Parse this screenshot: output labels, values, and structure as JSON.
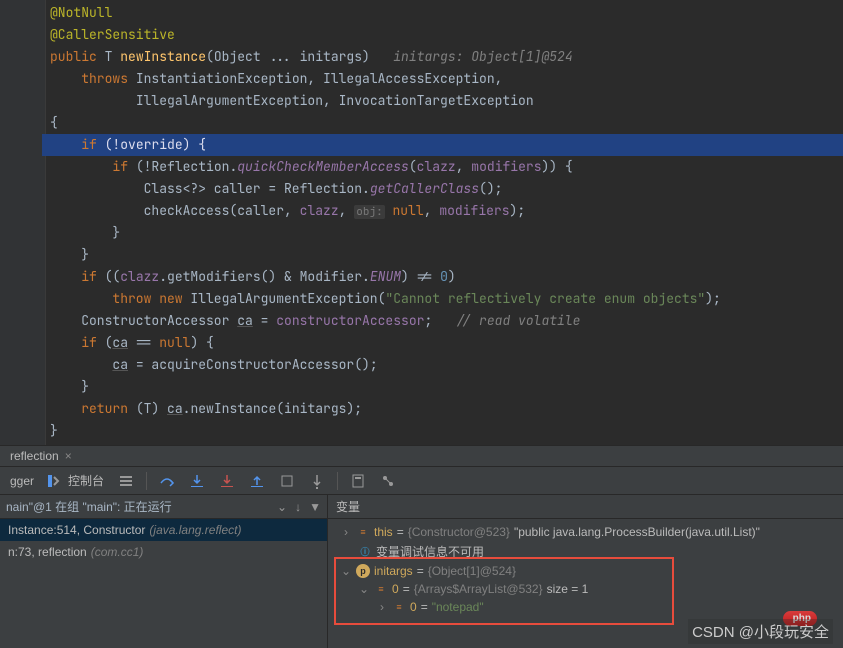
{
  "code": {
    "notnull": "@NotNull",
    "callersensitive": "@CallerSensitive",
    "sig_public": "public ",
    "sig_t": "T",
    "sig_method": " newInstance",
    "sig_args": "(Object ... initargs)",
    "sig_hint": "initargs: Object[1]@524",
    "throws": "throws",
    "ex1": " InstantiationException",
    "ex2": " IllegalAccessException",
    "ex3": "IllegalArgumentException",
    "ex4": " InvocationTargetException",
    "if": "if",
    "override": "override",
    "reflection": "Reflection",
    "quickcheck": "quickCheckMemberAccess",
    "clazz": "clazz",
    "modifiers": "modifiers",
    "class_decl": "Class<?> caller = Reflection.",
    "getcaller": "getCallerClass",
    "checkaccess": "checkAccess",
    "caller": "caller",
    "null": "null",
    "objhint": "obj:",
    "getmod": ".getModifiers() & Modifier.",
    "enum": "ENUM",
    "neq0": ") != ",
    "zero": "0",
    "throw": "throw new",
    "iae": " IllegalArgumentException(",
    "enummsg": "\"Cannot reflectively create enum objects\"",
    "ctoracc": "ConstructorAccessor ",
    "ca": "ca",
    "eqcons": " = ",
    "consacc": "constructorAccessor",
    "readvol": "// read volatile",
    "eqnull": " == ",
    "acquire": "acquireConstructorAccessor",
    "return": "return",
    "cast_t": "T",
    "newinst": ".newInstance(initargs);"
  },
  "tab": {
    "name": "reflection",
    "close": "×"
  },
  "toolbar": {
    "debugger_label": "gger",
    "console": "控制台"
  },
  "frames": {
    "thread": "nain\"@1 在组 \"main\": 正在运行",
    "row1_main": "Instance:514, Constructor",
    "row1_pkg": "(java.lang.reflect)",
    "row2_main": "n:73, reflection",
    "row2_pkg": "(com.cc1)"
  },
  "vars": {
    "header": "变量",
    "this_key": "this",
    "this_val": "{Constructor@523}",
    "this_str": " \"public java.lang.ProcessBuilder(java.util.List)\"",
    "unavail": "变量调试信息不可用",
    "initargs_key": "initargs",
    "initargs_val": "{Object[1]@524}",
    "idx0_key": "0",
    "idx0_val": "{Arrays$ArrayList@532}",
    "idx0_size": "  size = 1",
    "idx0_0_key": "0",
    "idx0_0_val": "\"notepad\"",
    "eq": " = "
  },
  "watermark": "CSDN @小段玩安全",
  "badge": "php"
}
